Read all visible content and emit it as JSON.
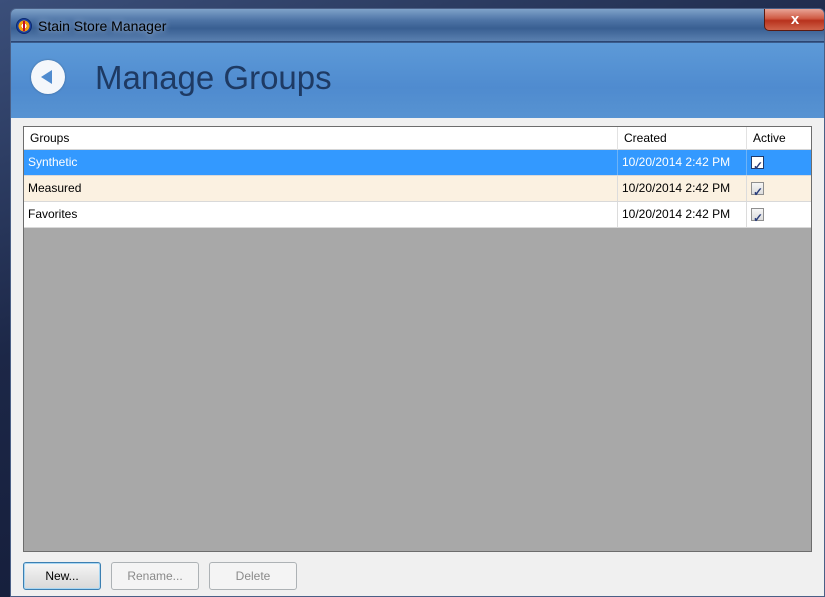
{
  "window": {
    "title": "Stain Store Manager",
    "close_label": "x"
  },
  "header": {
    "title": "Manage Groups",
    "back_icon": "back-arrow-icon"
  },
  "grid": {
    "columns": [
      "Groups",
      "Created",
      "Active"
    ],
    "rows": [
      {
        "group": "Synthetic",
        "created": "10/20/2014 2:42 PM",
        "active": true,
        "selected": true
      },
      {
        "group": "Measured",
        "created": "10/20/2014 2:42 PM",
        "active": true,
        "selected": false
      },
      {
        "group": "Favorites",
        "created": "10/20/2014 2:42 PM",
        "active": true,
        "selected": false
      }
    ]
  },
  "buttons": {
    "new_label": "New...",
    "rename_label": "Rename...",
    "delete_label": "Delete"
  },
  "colors": {
    "selection": "#3399ff",
    "alt_row": "#fbf1e1",
    "header_band": "#4f8bcf"
  }
}
